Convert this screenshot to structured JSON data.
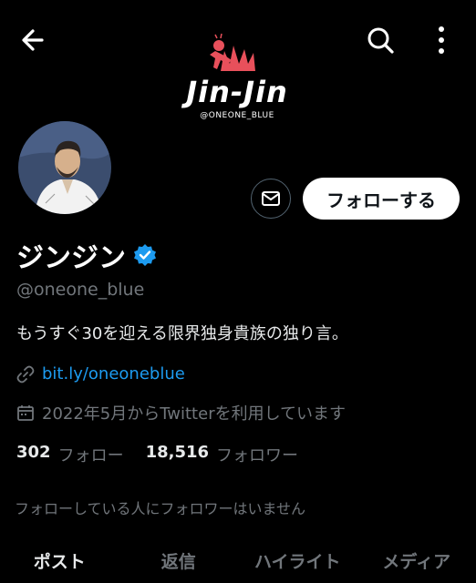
{
  "banner": {
    "title": "Jin-Jin",
    "subtitle": "@ONEONE_BLUE",
    "accent": "#e8505b"
  },
  "profile": {
    "display_name": "ジンジン",
    "verified": true,
    "handle": "@oneone_blue",
    "bio": "もうすぐ30を迎える限界独身貴族の独り言。",
    "link": "bit.ly/oneoneblue",
    "joined": "2022年5月からTwitterを利用しています",
    "following_count": "302",
    "following_label": "フォロー",
    "followers_count": "18,516",
    "followers_label": "フォロワー",
    "followed_note": "フォローしている人にフォロワーはいません"
  },
  "actions": {
    "follow_label": "フォローする"
  },
  "tabs": [
    {
      "label": "ポスト",
      "active": true
    },
    {
      "label": "返信",
      "active": false
    },
    {
      "label": "ハイライト",
      "active": false
    },
    {
      "label": "メディア",
      "active": false
    }
  ],
  "icons": {
    "back": "arrow-left-icon",
    "search": "search-icon",
    "more": "more-vertical-icon",
    "message": "mail-icon",
    "verified": "verified-badge-icon",
    "link": "link-icon",
    "calendar": "calendar-icon"
  },
  "colors": {
    "background": "#000000",
    "link": "#1d9bf0",
    "verified": "#1d9bf0",
    "muted": "#71767b"
  }
}
